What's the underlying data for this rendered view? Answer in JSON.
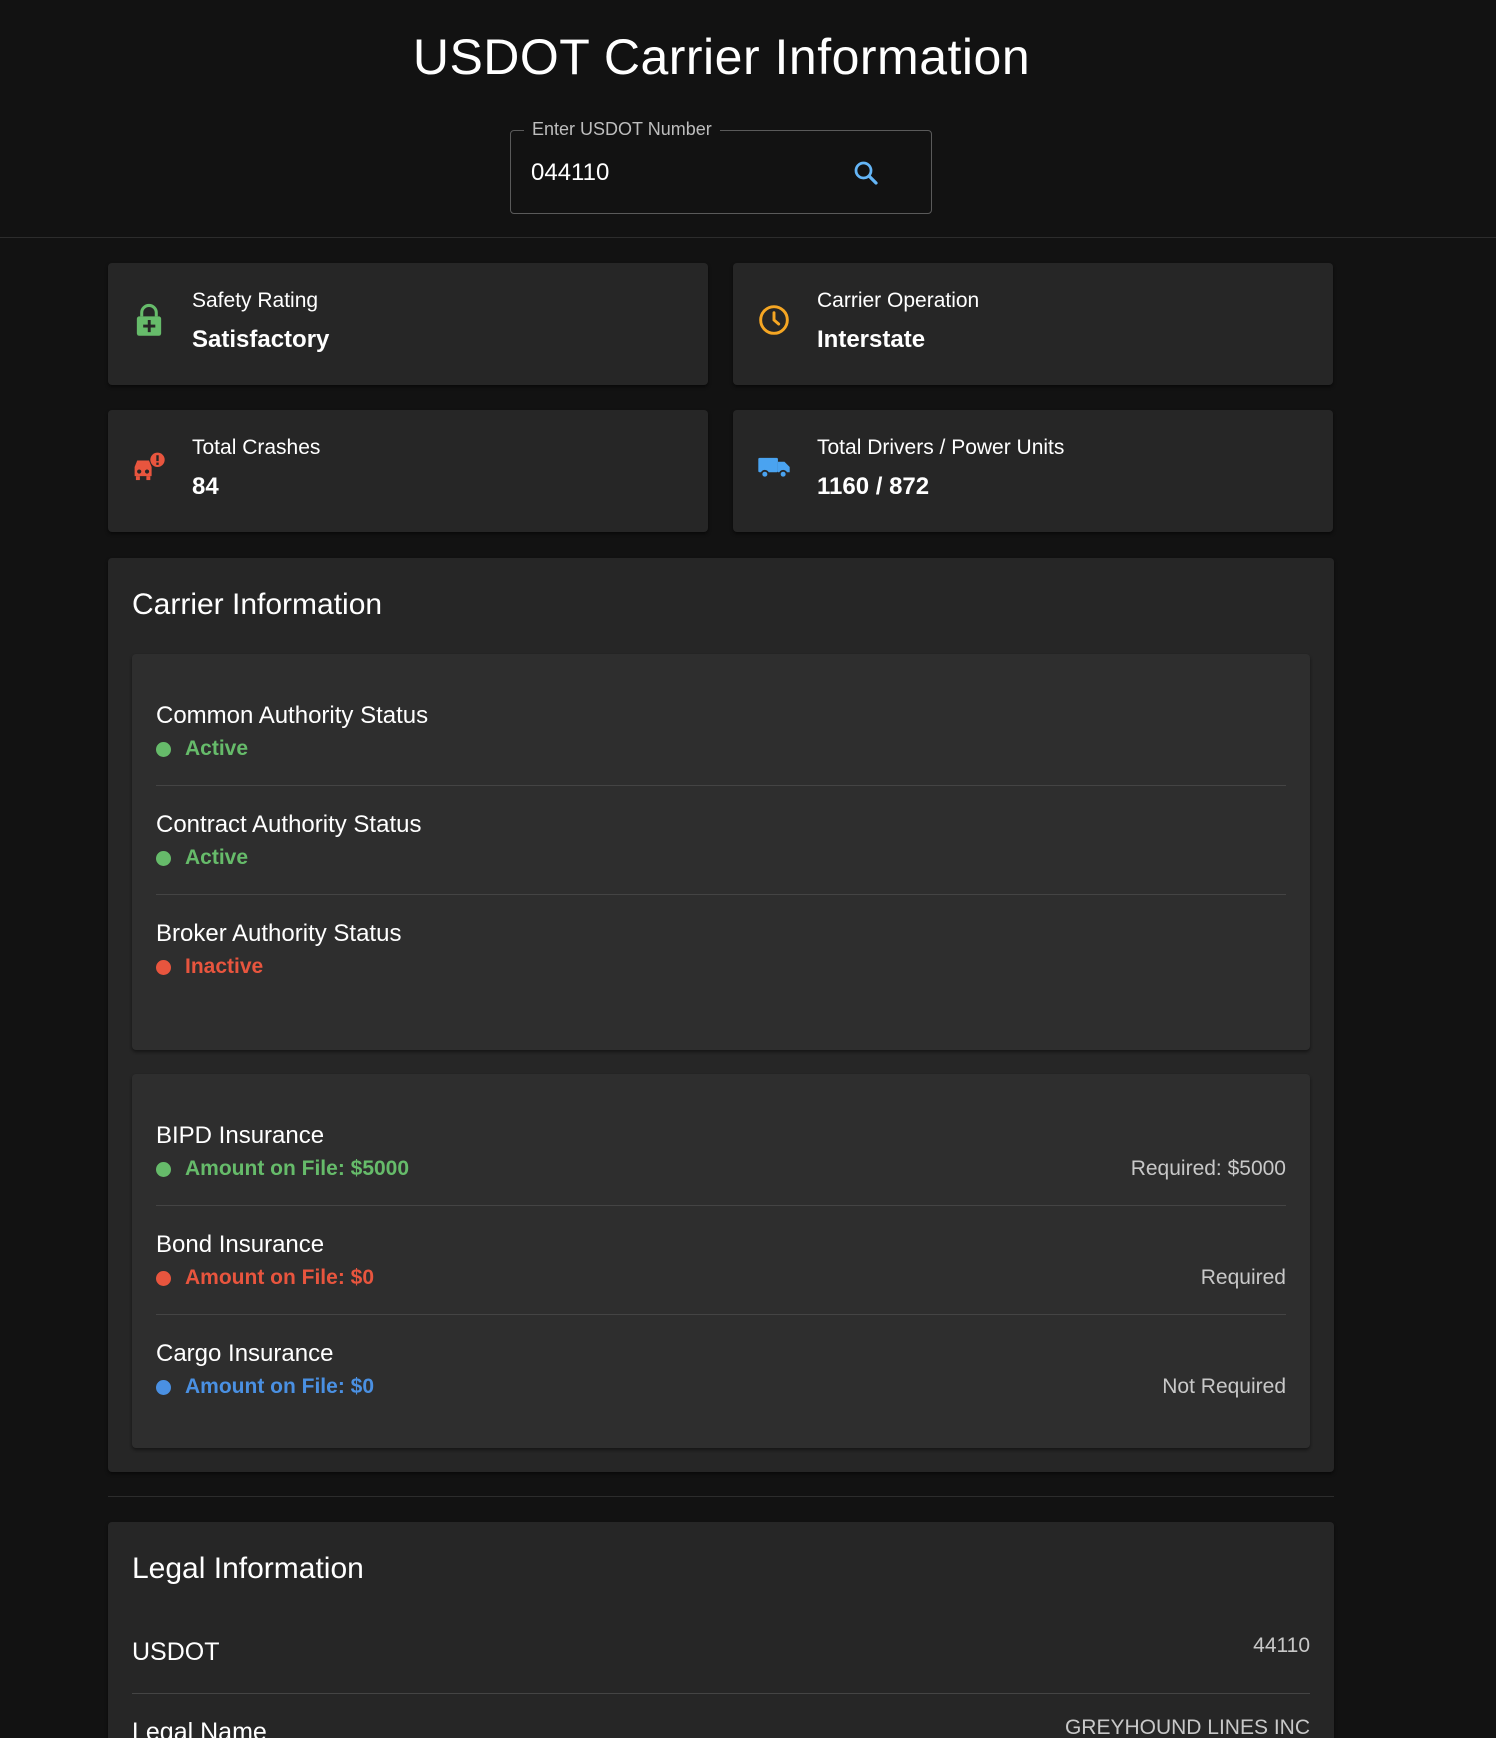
{
  "header": {
    "title": "USDOT Carrier Information",
    "search": {
      "legend": "Enter USDOT Number",
      "value": "044110",
      "icon": "search-icon"
    }
  },
  "stats": {
    "safety": {
      "label": "Safety Rating",
      "value": "Satisfactory",
      "icon": "lock-plus-icon",
      "color": "#66bb6a"
    },
    "operation": {
      "label": "Carrier Operation",
      "value": "Interstate",
      "icon": "clock-icon",
      "color": "#f5a623"
    },
    "crashes": {
      "label": "Total Crashes",
      "value": "84",
      "icon": "car-crash-icon",
      "color": "#e8553e"
    },
    "drivers": {
      "label": "Total Drivers / Power Units",
      "value": "1160 / 872",
      "icon": "truck-icon",
      "color": "#4aa3f0"
    }
  },
  "carrier_info": {
    "title": "Carrier Information",
    "authority": [
      {
        "label": "Common Authority Status",
        "status": "Active",
        "state": "green"
      },
      {
        "label": "Contract Authority Status",
        "status": "Active",
        "state": "green"
      },
      {
        "label": "Broker Authority Status",
        "status": "Inactive",
        "state": "red"
      }
    ],
    "insurance": [
      {
        "label": "BIPD Insurance",
        "status": "Amount on File: $5000",
        "state": "green",
        "requirement": "Required: $5000"
      },
      {
        "label": "Bond Insurance",
        "status": "Amount on File: $0",
        "state": "red",
        "requirement": "Required"
      },
      {
        "label": "Cargo Insurance",
        "status": "Amount on File: $0",
        "state": "blue",
        "requirement": "Not Required"
      }
    ]
  },
  "legal_info": {
    "title": "Legal Information",
    "rows": [
      {
        "label": "USDOT",
        "value": "44110"
      },
      {
        "label": "Legal Name",
        "value": "GREYHOUND LINES INC"
      }
    ]
  },
  "colors": {
    "background": "#121212",
    "card": "#262626",
    "inner_card": "#2e2e2e",
    "green": "#66bb6a",
    "red": "#e8553e",
    "blue": "#4a90e2",
    "orange": "#f5a623",
    "search_icon": "#64b5f6"
  }
}
